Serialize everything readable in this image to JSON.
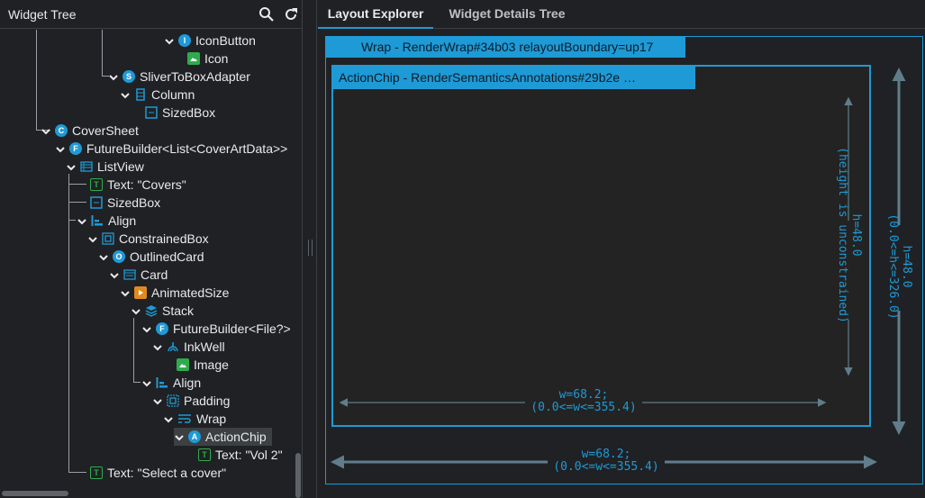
{
  "left_panel": {
    "title": "Widget Tree",
    "search_icon": "search-icon",
    "refresh_icon": "refresh-icon",
    "tree_nodes": [
      {
        "label": "IconButton",
        "icon": "I",
        "kind": "circle",
        "chevron": true
      },
      {
        "label": "Icon",
        "icon": "image",
        "kind": "green",
        "chevron": false
      },
      {
        "label": "SliverToBoxAdapter",
        "icon": "S",
        "kind": "circle",
        "chevron": true
      },
      {
        "label": "Column",
        "icon": "column",
        "kind": "column",
        "chevron": true
      },
      {
        "label": "SizedBox",
        "icon": "sizedbox",
        "kind": "sizedbox",
        "chevron": false
      },
      {
        "label": "CoverSheet",
        "icon": "C",
        "kind": "circle",
        "chevron": true
      },
      {
        "label": "FutureBuilder<List<CoverArtData>>",
        "icon": "F",
        "kind": "circle",
        "chevron": true
      },
      {
        "label": "ListView",
        "icon": "listview",
        "kind": "listview",
        "chevron": true
      },
      {
        "label": "Text: \"Covers\"",
        "icon": "T",
        "kind": "text",
        "chevron": false
      },
      {
        "label": "SizedBox",
        "icon": "sizedbox",
        "kind": "sizedbox",
        "chevron": false
      },
      {
        "label": "Align",
        "icon": "align",
        "kind": "align",
        "chevron": true
      },
      {
        "label": "ConstrainedBox",
        "icon": "constrained",
        "kind": "constrained",
        "chevron": true
      },
      {
        "label": "OutlinedCard",
        "icon": "O",
        "kind": "circle",
        "chevron": true
      },
      {
        "label": "Card",
        "icon": "card",
        "kind": "card",
        "chevron": true
      },
      {
        "label": "AnimatedSize",
        "icon": "animated",
        "kind": "orange",
        "chevron": true
      },
      {
        "label": "Stack",
        "icon": "stack",
        "kind": "stack",
        "chevron": true
      },
      {
        "label": "FutureBuilder<File?>",
        "icon": "F",
        "kind": "circle",
        "chevron": true
      },
      {
        "label": "InkWell",
        "icon": "inkwell",
        "kind": "inkwell",
        "chevron": true
      },
      {
        "label": "Image",
        "icon": "image",
        "kind": "green",
        "chevron": false
      },
      {
        "label": "Align",
        "icon": "align",
        "kind": "align",
        "chevron": true
      },
      {
        "label": "Padding",
        "icon": "padding",
        "kind": "padding",
        "chevron": true
      },
      {
        "label": "Wrap",
        "icon": "wrap",
        "kind": "wrap",
        "chevron": true
      },
      {
        "label": "ActionChip",
        "icon": "A",
        "kind": "circle",
        "chevron": true,
        "selected": true
      },
      {
        "label": "Text: \"Vol 2\"",
        "icon": "T",
        "kind": "text",
        "chevron": false
      },
      {
        "label": "Text: \"Select a cover\"",
        "icon": "T",
        "kind": "text",
        "chevron": false
      }
    ]
  },
  "right_panel": {
    "tabs": [
      {
        "label": "Layout Explorer",
        "active": true
      },
      {
        "label": "Widget Details Tree",
        "active": false
      }
    ],
    "outer_box_label": "Wrap - RenderWrap#34b03 relayoutBoundary=up17",
    "inner_box_label": "ActionChip - RenderSemanticsAnnotations#29b2e …",
    "inner_height_line1": "h=48.0",
    "inner_height_line2": "(height is unconstrained)",
    "inner_width_line1": "w=68.2;",
    "inner_width_line2": "(0.0<=w<=355.4)",
    "outer_height_line1": "h=48.0",
    "outer_height_line2": "(0.0<=h<=326.0)",
    "outer_width_line1": "w=68.2;",
    "outer_width_line2": "(0.0<=w<=355.4)"
  },
  "colors": {
    "accent": "#1e9ad6",
    "background": "#202124",
    "text": "#e8eaed",
    "green_icon": "#2eac4d",
    "orange_icon": "#e08a1e"
  }
}
